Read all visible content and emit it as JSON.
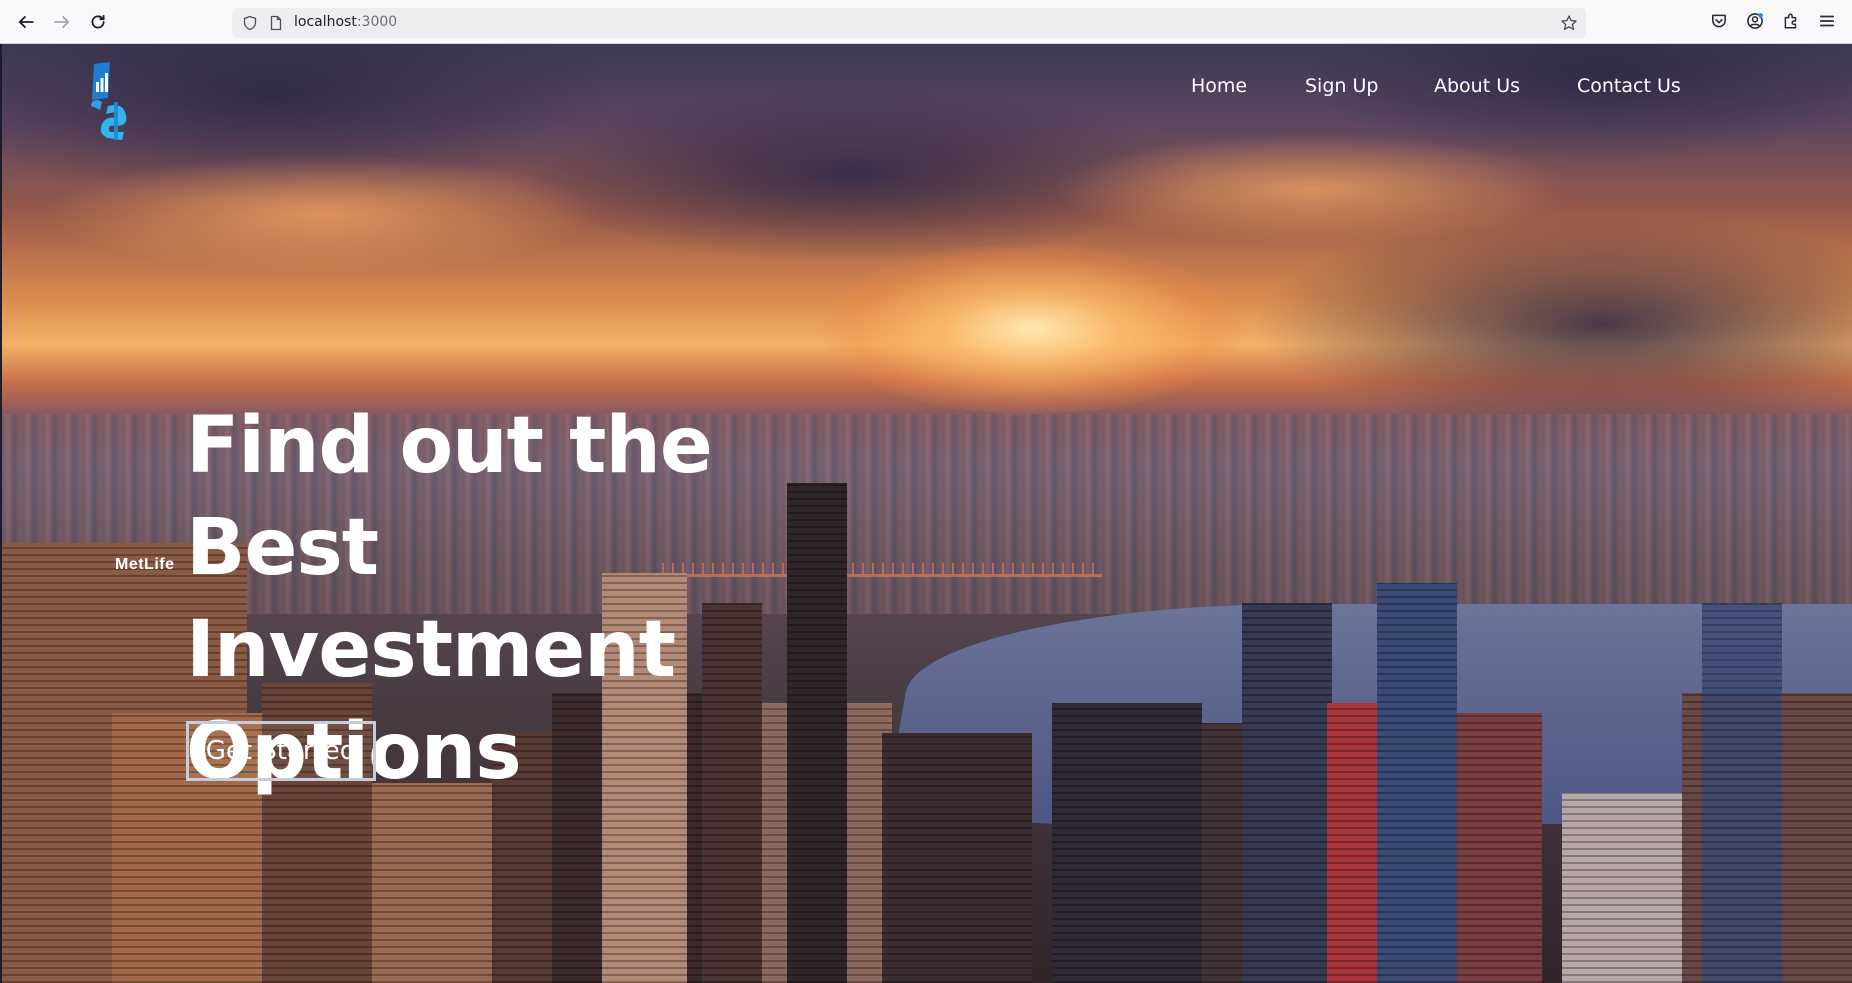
{
  "browser": {
    "url_host": "localhost",
    "url_port": ":3000",
    "icons": {
      "back": "arrow-left-icon",
      "forward": "arrow-right-icon",
      "reload": "reload-icon",
      "tracking": "shield-icon",
      "page": "page-icon",
      "bookmark": "star-icon",
      "pocket": "pocket-icon",
      "account": "account-icon",
      "extensions": "puzzle-icon",
      "menu": "hamburger-menu-icon"
    }
  },
  "site": {
    "logo": "bar-chart-dollar-logo",
    "nav": [
      {
        "label": "Home"
      },
      {
        "label": "Sign Up"
      },
      {
        "label": "About Us"
      },
      {
        "label": "Contact Us"
      }
    ],
    "hero": {
      "headline_line1": "Find out the Best",
      "headline_line2": "Investment",
      "headline_line3": "Options",
      "cta_label": "Get Started",
      "sign_text": "MetLife"
    }
  },
  "colors": {
    "accent_logo": "#1e9ad6",
    "nav_text": "#ffffff",
    "cta_border": "#c7cdd8"
  }
}
